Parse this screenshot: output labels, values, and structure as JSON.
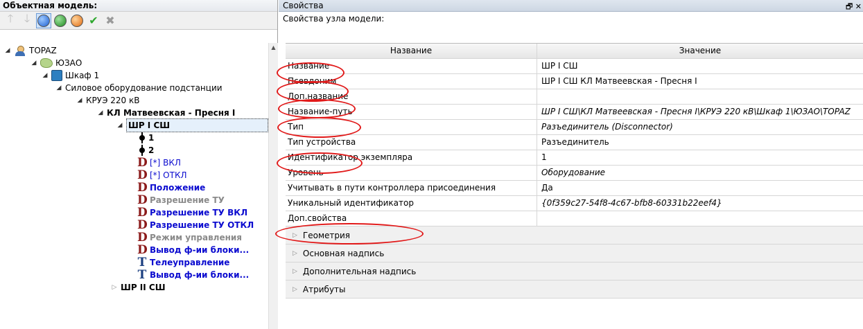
{
  "left_panel": {
    "title": "Объектная модель:"
  },
  "tree": [
    {
      "label": "TOPAZ",
      "icon": "person-icon",
      "expanded": true
    },
    {
      "label": "ЮЗАО",
      "icon": "region-icon",
      "expanded": true
    },
    {
      "label": "Шкаф 1",
      "icon": "cabinet-icon",
      "expanded": true
    },
    {
      "label": "Силовое оборудование подстанции",
      "expanded": true
    },
    {
      "label": "КРУЭ 220 кВ",
      "expanded": true
    },
    {
      "label": "КЛ Матвеевская - Пресня I",
      "expanded": true
    },
    {
      "label": "ШР I СШ",
      "expanded": true
    },
    {
      "label": "1",
      "icon": "pin-icon"
    },
    {
      "label": "2",
      "icon": "pin-icon"
    },
    {
      "label": "[*] ВКЛ",
      "icon": "D"
    },
    {
      "label": "[*] ОТКЛ",
      "icon": "D"
    },
    {
      "label": "Положение",
      "icon": "D"
    },
    {
      "label": "Разрешение ТУ",
      "icon": "D"
    },
    {
      "label": "Разрешение ТУ ВКЛ",
      "icon": "D"
    },
    {
      "label": "Разрешение ТУ ОТКЛ",
      "icon": "D"
    },
    {
      "label": "Режим управления",
      "icon": "D"
    },
    {
      "label": "Вывод ф-ии блоки...",
      "icon": "D"
    },
    {
      "label": "Телеуправление",
      "icon": "T"
    },
    {
      "label": "Вывод ф-ии блоки...",
      "icon": "T"
    },
    {
      "label": "ШР II СШ",
      "expanded": false
    }
  ],
  "right_panel": {
    "title": "Свойства",
    "subtitle": "Свойства узла модели:",
    "pin_glyph": "🗗 ✕",
    "col_name": "Название",
    "col_value": "Значение"
  },
  "properties": [
    {
      "name": "Название",
      "value": "ШР I СШ",
      "italic": false
    },
    {
      "name": "Псевдоним",
      "value": "ШР I СШ КЛ Матвеевская - Пресня I",
      "italic": false
    },
    {
      "name": "Доп.название",
      "value": "",
      "italic": false
    },
    {
      "name": "Название-путь",
      "value": "ШР I СШ\\КЛ Матвеевская - Пресня I\\КРУЭ 220 кВ\\Шкаф 1\\ЮЗАО\\TOPAZ",
      "italic": true
    },
    {
      "name": "Тип",
      "value": "Разъединитель (Disconnector)",
      "italic": true
    },
    {
      "name": "Тип устройства",
      "value": "Разъединитель",
      "italic": false
    },
    {
      "name": "Идентификатор экземпляра",
      "value": "1",
      "italic": false
    },
    {
      "name": "Уровень",
      "value": "Оборудование",
      "italic": true
    },
    {
      "name": "Учитывать в пути контроллера присоединения",
      "value": "Да",
      "italic": false
    },
    {
      "name": "Уникальный идентификатор",
      "value": "{0f359c27-54f8-4c67-bfb8-60331b22eef4}",
      "italic": true
    },
    {
      "name": "Доп.свойства",
      "value": "",
      "italic": false
    }
  ],
  "groups": [
    "Геометрия",
    "Основная надпись",
    "Дополнительная надпись",
    "Атрибуты"
  ],
  "colors": {
    "highlight": "#e11919",
    "link_blue": "#0b0bcf",
    "d_icon": "#8b1a1a"
  }
}
